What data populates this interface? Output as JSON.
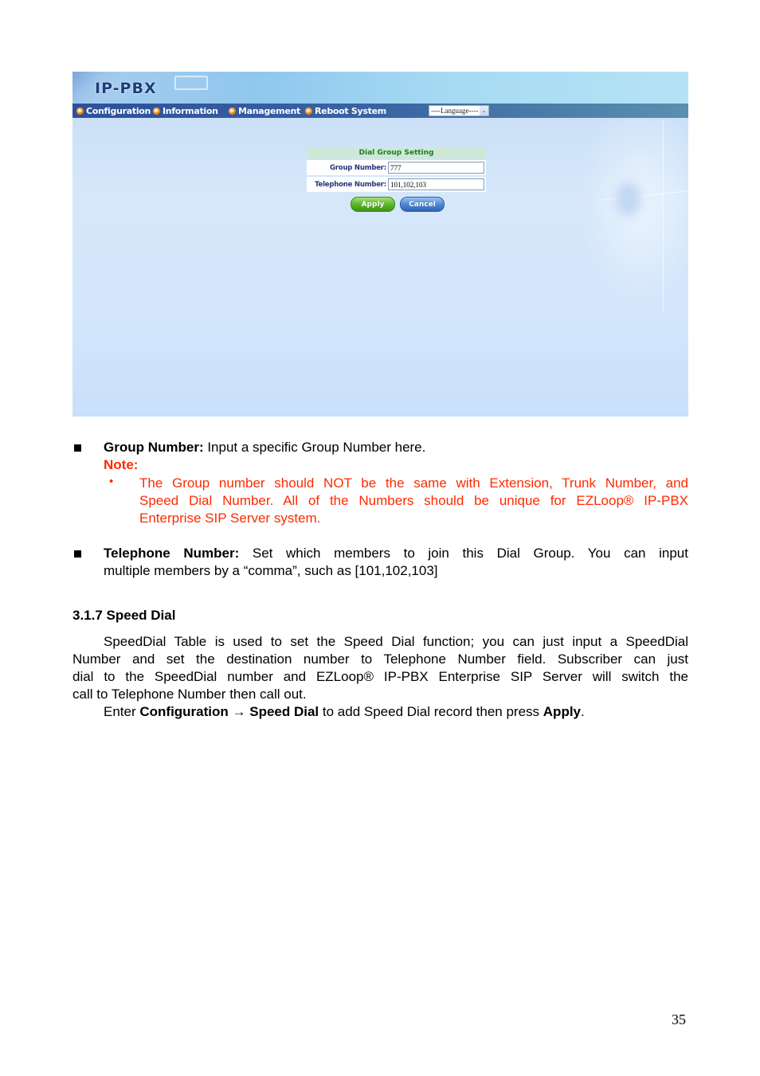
{
  "screenshot": {
    "app_logo": "IP-PBX",
    "nav": {
      "items": [
        {
          "label": "Configuration",
          "icon": "orange-arrow-bullet-icon"
        },
        {
          "label": "Information",
          "icon": "orange-arrow-bullet-icon"
        },
        {
          "label": "Management",
          "icon": "orange-arrow-bullet-icon"
        },
        {
          "label": "Reboot System",
          "icon": "orange-arrow-bullet-icon"
        }
      ],
      "language_select": {
        "selected": "----Language----",
        "icon": "chevron-down-icon"
      }
    },
    "form": {
      "title": "Dial Group Setting",
      "fields": [
        {
          "label": "Group Number:",
          "value": "777"
        },
        {
          "label": "Telephone Number:",
          "value": "101,102,103"
        }
      ],
      "apply_label": "Apply",
      "cancel_label": "Cancel"
    }
  },
  "document": {
    "group_number": {
      "term": "Group Number:",
      "desc": " Input a specific Group Number here.",
      "note_label": "Note:",
      "note_lines": [
        "The Group number should NOT be the same with Extension, Trunk Number, and",
        "Speed Dial Number. All of the Numbers should be unique for EZLoop® IP-PBX",
        "Enterprise SIP Server system."
      ]
    },
    "telephone_number": {
      "term": "Telephone Number:",
      "desc_line1": " Set which members to join this Dial Group. You can input",
      "desc_line2": "multiple members by a “comma”, such as [101,102,103]"
    },
    "section": {
      "heading": "3.1.7 Speed Dial",
      "para_lines": [
        "SpeedDial Table is used to set the Speed Dial function; you can just input a SpeedDial",
        "Number and set the destination number to Telephone Number field. Subscriber can just",
        "dial to the SpeedDial number and EZLoop® IP-PBX Enterprise SIP Server will switch the",
        "call to Telephone Number then call out."
      ],
      "enter_prefix": "Enter ",
      "enter_path_1": "Configuration",
      "enter_arrow": " → ",
      "enter_path_2": "Speed Dial",
      "enter_middle": " to add Speed Dial record then press ",
      "enter_apply": "Apply",
      "enter_suffix": "."
    },
    "page_number": "35"
  }
}
